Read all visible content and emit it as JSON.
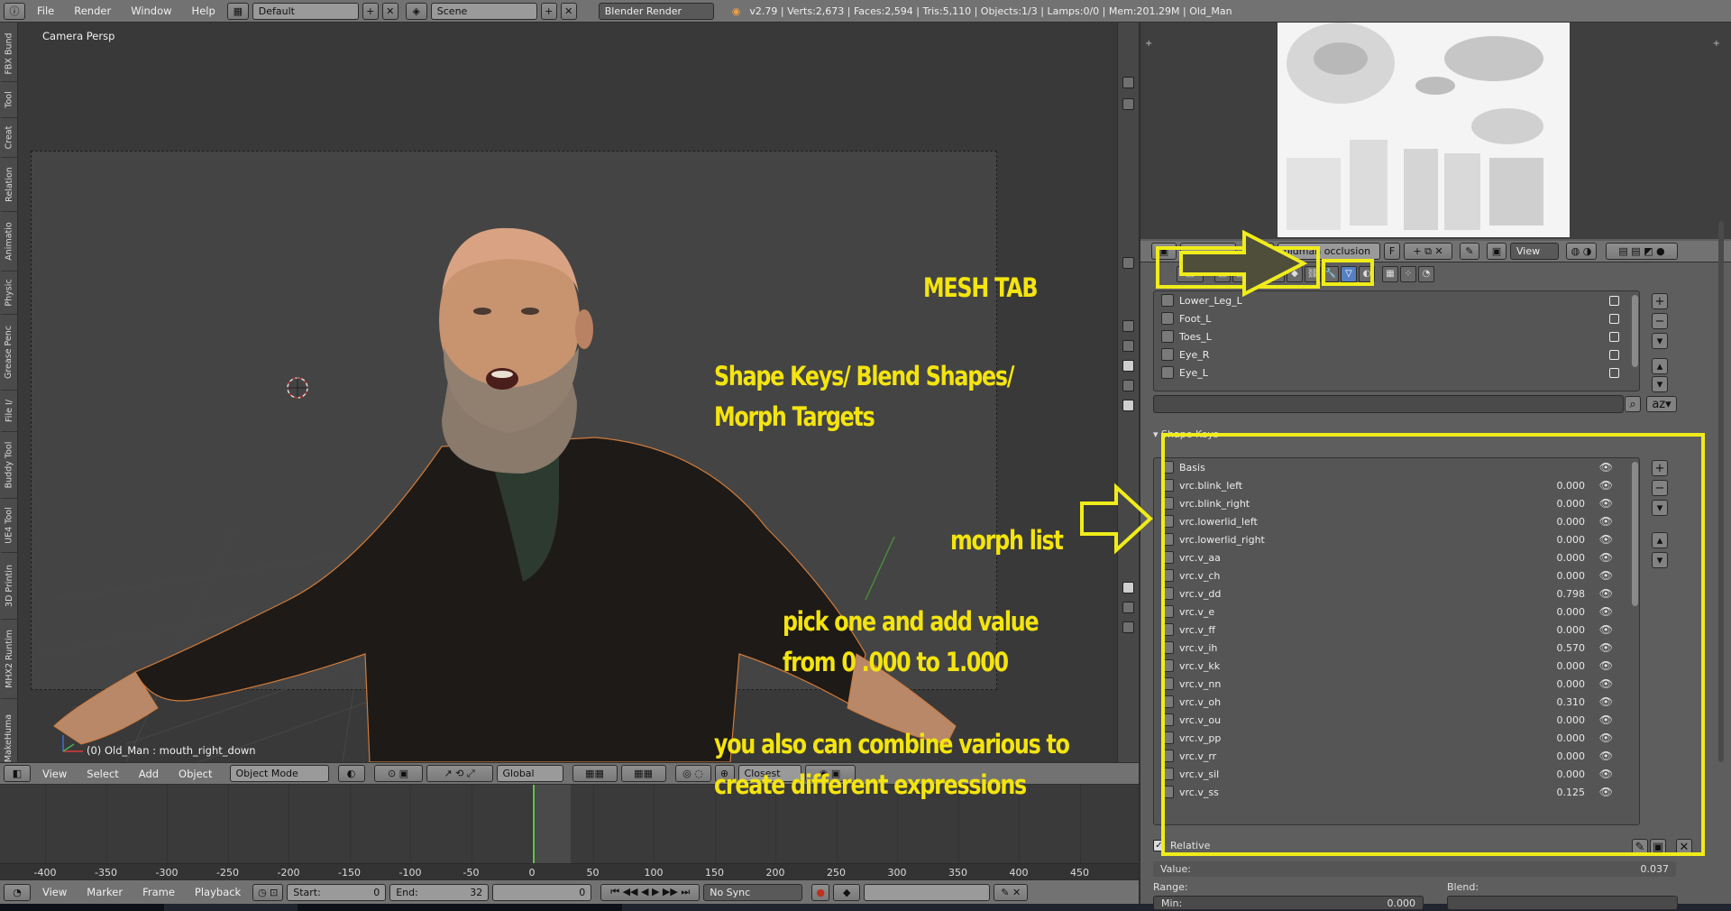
{
  "topbar": {
    "menus": [
      "File",
      "Render",
      "Window",
      "Help"
    ],
    "layout": "Default",
    "scene": "Scene",
    "engine": "Blender Render",
    "stats": "v2.79 | Verts:2,673 | Faces:2,594 | Tris:5,110 | Objects:1/3 | Lamps:0/0 | Mem:201.29M | Old_Man"
  },
  "tool_tabs": [
    "FBX Bund",
    "Tool",
    "Creat",
    "Relation",
    "Animatio",
    "Physic",
    "Grease Penc",
    "File I/",
    "Buddy Tool",
    "UE4 Tool",
    "3D Printin",
    "MHX2 Runtim",
    "MakeHuma"
  ],
  "viewport": {
    "label": "Camera Persp",
    "object_label": "(0) Old_Man : mouth_right_down"
  },
  "annotations": {
    "mesh_tab": "MESH TAB",
    "shape_keys": [
      "Shape Keys/ Blend Shapes/",
      "Morph Targets"
    ],
    "morph_list": "morph list",
    "pick_one": [
      "pick one and add value",
      "from 0 .000 to 1.000"
    ],
    "combine": [
      "you also can combine various to",
      "create different expressions"
    ]
  },
  "vp_header": {
    "menus": [
      "View",
      "Select",
      "Add",
      "Object"
    ],
    "mode": "Object Mode",
    "orientation": "Global",
    "snap": "Closest"
  },
  "timeline": {
    "ticks": [
      "-400",
      "-350",
      "-300",
      "-250",
      "-200",
      "-150",
      "-100",
      "-50",
      "0",
      "50",
      "100",
      "150",
      "200",
      "250",
      "300",
      "350",
      "400",
      "450"
    ],
    "current_frame": 0
  },
  "tl_header": {
    "menus": [
      "View",
      "Marker",
      "Frame",
      "Playback"
    ],
    "start_label": "Start:",
    "start_value": "0",
    "end_label": "End:",
    "end_value": "32",
    "current": "0",
    "sync": "No Sync"
  },
  "props": {
    "image_name": "oldman occlusion",
    "f_label": "F",
    "view_label": "View",
    "vertex_groups": [
      "Lower_Leg_L",
      "Foot_L",
      "Toes_L",
      "Eye_R",
      "Eye_L"
    ],
    "panel_title": "Shape Keys",
    "shape_keys": [
      {
        "name": "Basis",
        "value": ""
      },
      {
        "name": "vrc.blink_left",
        "value": "0.000"
      },
      {
        "name": "vrc.blink_right",
        "value": "0.000"
      },
      {
        "name": "vrc.lowerlid_left",
        "value": "0.000"
      },
      {
        "name": "vrc.lowerlid_right",
        "value": "0.000"
      },
      {
        "name": "vrc.v_aa",
        "value": "0.000"
      },
      {
        "name": "vrc.v_ch",
        "value": "0.000"
      },
      {
        "name": "vrc.v_dd",
        "value": "0.798"
      },
      {
        "name": "vrc.v_e",
        "value": "0.000"
      },
      {
        "name": "vrc.v_ff",
        "value": "0.000"
      },
      {
        "name": "vrc.v_ih",
        "value": "0.570"
      },
      {
        "name": "vrc.v_kk",
        "value": "0.000"
      },
      {
        "name": "vrc.v_nn",
        "value": "0.000"
      },
      {
        "name": "vrc.v_oh",
        "value": "0.310"
      },
      {
        "name": "vrc.v_ou",
        "value": "0.000"
      },
      {
        "name": "vrc.v_pp",
        "value": "0.000"
      },
      {
        "name": "vrc.v_rr",
        "value": "0.000"
      },
      {
        "name": "vrc.v_sil",
        "value": "0.000"
      },
      {
        "name": "vrc.v_ss",
        "value": "0.125"
      }
    ],
    "relative_label": "Relative",
    "value_label": "Value:",
    "value_value": "0.037",
    "range_label": "Range:",
    "blend_label": "Blend:",
    "min_label": "Min:",
    "min_value": "0.000"
  },
  "colors": {
    "annotation": "#f4e40f",
    "active_tab": "#5680c2",
    "playhead": "#5fc24c"
  }
}
